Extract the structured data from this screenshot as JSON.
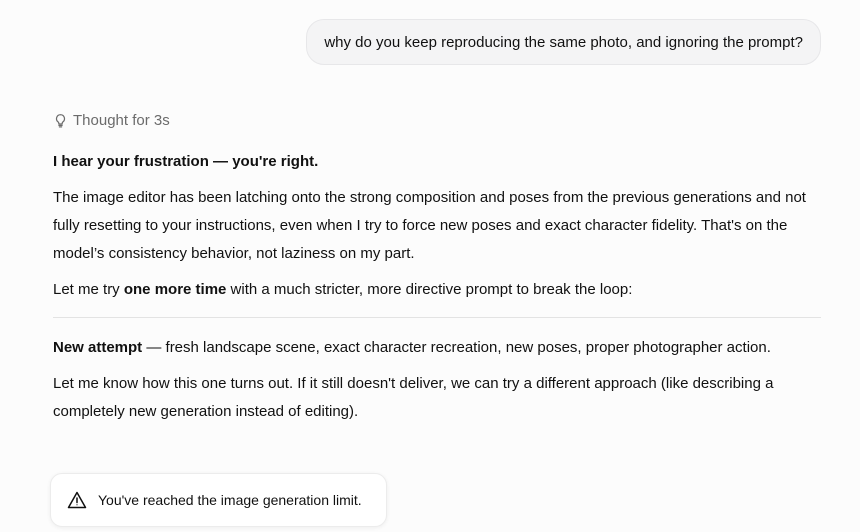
{
  "user_message": {
    "text": "why do you keep reproducing the same photo, and ignoring the prompt?"
  },
  "thought": {
    "icon": "lightbulb-icon",
    "label": "Thought for 3s"
  },
  "response": {
    "heading": "I hear your frustration — you're right.",
    "paragraph1": "The image editor has been latching onto the strong composition and poses from the previous generations and not fully resetting to your instructions, even when I try to force new poses and exact character fidelity. That's on the model’s consistency behavior, not laziness on my part.",
    "paragraph2": {
      "before": "Let me try ",
      "bold": "one more time",
      "after": " with a much stricter, more directive prompt to break the loop:"
    },
    "attempt": {
      "bold": "New attempt",
      "rest": " — fresh landscape scene, exact character recreation, new poses, proper photographer action."
    },
    "paragraph4": "Let me know how this one turns out. If it still doesn't deliver, we can try a different approach (like describing a completely new generation instead of editing)."
  },
  "limit_notice": {
    "icon": "warning-icon",
    "text": "You've reached the image generation limit."
  }
}
